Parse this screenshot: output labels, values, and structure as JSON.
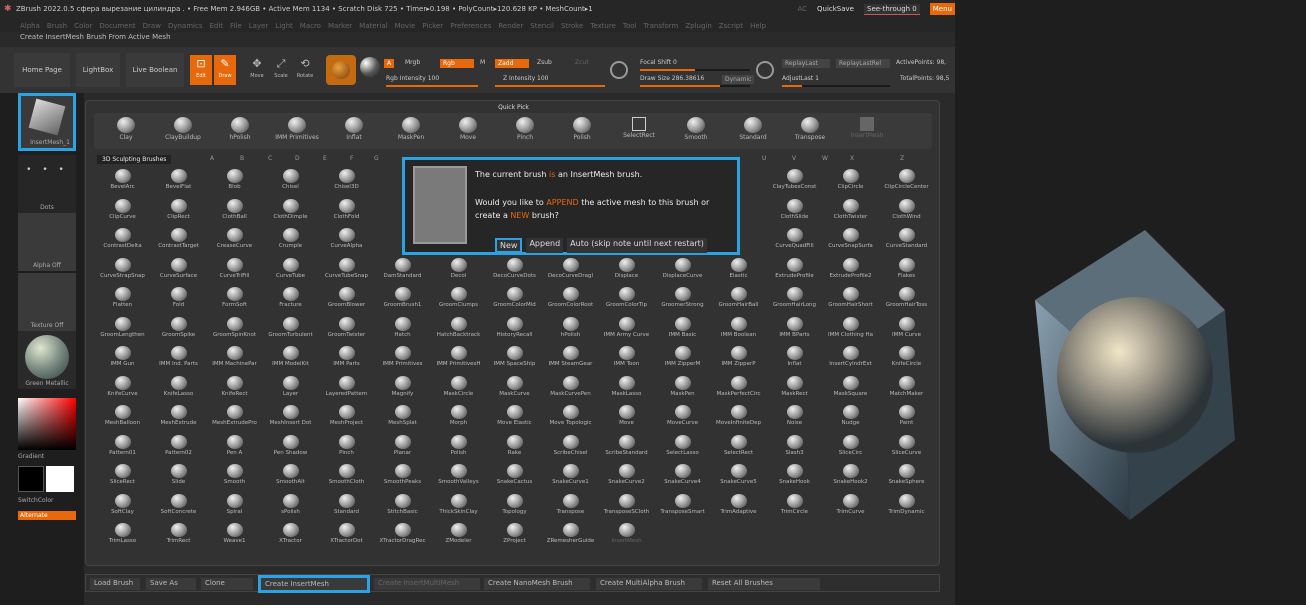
{
  "titlebar": {
    "title": "ZBrush 2022.0.5  сфера вырезание цилиндра  . • Free Mem 2.946GB • Active Mem 1134 • Scratch Disk 725 • Timer▸0.198 • PolyCount▸120.628 KP • MeshCount▸1",
    "ac": "AC",
    "quicksave": "QuickSave",
    "seethrough": "See-through  0",
    "menus": "Menu"
  },
  "menubar": [
    "Alpha",
    "Brush",
    "Color",
    "Document",
    "Draw",
    "Dynamics",
    "Edit",
    "File",
    "Layer",
    "Light",
    "Macro",
    "Marker",
    "Material",
    "Movie",
    "Picker",
    "Preferences",
    "Render",
    "Stencil",
    "Stroke",
    "Texture",
    "Tool",
    "Transform",
    "Zplugin",
    "Zscript",
    "Help"
  ],
  "subtitle": "Create InsertMesh Brush From Active Mesh",
  "toolbar": {
    "home": "Home Page",
    "lightbox": "LightBox",
    "liveboolean": "Live Boolean",
    "edit": "Edit",
    "draw": "Draw",
    "move": "Move",
    "scale": "Scale",
    "rotate": "Rotate",
    "mrgb": "Mrgb",
    "rgb": "Rgb",
    "m": "M",
    "zadd": "Zadd",
    "zsub": "Zsub",
    "zcut": "Zcut",
    "rgb_int": "Rgb Intensity 100",
    "z_int": "Z Intensity 100",
    "a": "A",
    "focal": "Focal Shift 0",
    "drawsize": "Draw Size 286.38616",
    "dynamic": "Dynamic",
    "replaylast": "ReplayLast",
    "replaylastrel": "ReplayLastRel",
    "adjustlast": "AdjustLast 1",
    "activepoints": "ActivePoints: 98,",
    "totalpoints": "TotalPoints: 98,5"
  },
  "left": {
    "insertmesh": "InsertMesh_1",
    "dots": "Dots",
    "alphaoff": "Alpha Off",
    "textureoff": "Texture Off",
    "material": "Green Metallic",
    "gradient": "Gradient",
    "switchcolor": "SwitchColor",
    "alternate": "Alternate"
  },
  "quickpick": {
    "title": "Quick Pick",
    "items": [
      "Clay",
      "ClayBuildup",
      "hPolish",
      "IMM Primitives",
      "Inflat",
      "MaskPen",
      "Move",
      "Pinch",
      "Polish",
      "SelectRect",
      "Smooth",
      "Standard",
      "Transpose",
      "InsertMesh"
    ],
    "imm_count": "14",
    "im_count": "1"
  },
  "tabs": {
    "label": "3D Sculpting Brushes",
    "letters": [
      "A",
      "B",
      "C",
      "D",
      "E",
      "F",
      "G",
      "U",
      "V",
      "W",
      "X",
      "Z"
    ]
  },
  "grid": [
    [
      "BevelArc",
      "BevelFlat",
      "Blob",
      "Chisel",
      "Chisel3D",
      "ChiselC",
      "",
      "",
      "",
      "",
      "",
      "",
      "ClayTubesConst",
      "ClipCircle",
      "ClipCircleCenter"
    ],
    [
      "ClipCurve",
      "ClipRect",
      "ClothBall",
      "ClothDimple",
      "ClothFold",
      "Cloth",
      "",
      "",
      "",
      "",
      "",
      "",
      "ClothSlide",
      "ClothTwister",
      "ClothWind"
    ],
    [
      "ContrastDelta",
      "ContrastTarget",
      "CreaseCurve",
      "Crumple",
      "CurveAlpha",
      "Curve",
      "",
      "",
      "",
      "",
      "",
      "",
      "CurveQuadFill",
      "CurveSnapSurfa",
      "CurveStandard"
    ],
    [
      "CurveStrapSnap",
      "CurveSurface",
      "CurveTriFill",
      "CurveTube",
      "CurveTubeSnap",
      "DamStandard",
      "Decol",
      "DecoCurveDots",
      "DecoCurveDragl",
      "Displace",
      "DisplaceCurve",
      "Elastic",
      "ExtrudeProfile",
      "ExtrudeProfile2",
      "Flakes"
    ],
    [
      "Flatten",
      "Fold",
      "FormSoft",
      "Fracture",
      "GroomBlower",
      "GroomBrush1",
      "GroomClumps",
      "GroomColorMid",
      "GroomColorRoot",
      "GroomColorTip",
      "GroomerStrong",
      "GroomHairBall",
      "GroomHairLong",
      "GroomHairShort",
      "GroomHairToss"
    ],
    [
      "GroomLengthen",
      "GroomSpike",
      "GroomSpinKnot",
      "GroomTurbulent",
      "GroomTwister",
      "Hatch",
      "HatchBacktrack",
      "HistoryRecall",
      "hPolish",
      "IMM Army Curve",
      "IMM Basic",
      "IMM Boolean",
      "IMM BParts",
      "IMM Clothing Ha",
      "IMM Curve"
    ],
    [
      "IMM Gun",
      "IMM Ind. Parts",
      "IMM MachinePar",
      "IMM ModelKit",
      "IMM Parts",
      "IMM Primitives",
      "IMM PrimitivesH",
      "IMM SpaceShip",
      "IMM SteamGear",
      "IMM Toon",
      "IMM ZipperM",
      "IMM ZipperP",
      "Inflat",
      "InsertCylndrExt",
      "KnifeCircle"
    ],
    [
      "KnifeCurve",
      "KnifeLasso",
      "KnifeRect",
      "Layer",
      "LayeredPattern",
      "Magnify",
      "MaskCircle",
      "MaskCurve",
      "MaskCurvePen",
      "MaskLasso",
      "MaskPen",
      "MaskPerfectCirc",
      "MaskRect",
      "MaskSquare",
      "MatchMaker"
    ],
    [
      "MeshBalloon",
      "MeshExtrude",
      "MeshExtrudePro",
      "MeshInsert Dot",
      "MeshProject",
      "MeshSplat",
      "Morph",
      "Move Elastic",
      "Move Topologic",
      "Move",
      "MoveCurve",
      "MoveInfiniteDep",
      "Noise",
      "Nudge",
      "Paint"
    ],
    [
      "Pattern01",
      "Pattern02",
      "Pen A",
      "Pen Shadow",
      "Pinch",
      "Planar",
      "Polish",
      "Rake",
      "ScribeChisel",
      "ScribeStandard",
      "SelectLasso",
      "SelectRect",
      "Slash3",
      "SliceCirc",
      "SliceCurve"
    ],
    [
      "SliceRect",
      "Slide",
      "Smooth",
      "SmoothAlt",
      "SmoothCloth",
      "SmoothPeaks",
      "SmoothValleys",
      "SnakeCactus",
      "SnakeCurve1",
      "SnakeCurve2",
      "SnakeCurve4",
      "SnakeCurve5",
      "SnakeHook",
      "SnakeHook2",
      "SnakeSphere"
    ],
    [
      "SoftClay",
      "SoftConcrete",
      "Spiral",
      "sPolish",
      "Standard",
      "StitchBasic",
      "ThickSkinClay",
      "Topology",
      "Transpose",
      "TransposeSCloth",
      "TransposeSmart",
      "TrimAdaptive",
      "TrimCircle",
      "TrimCurve",
      "TrimDynamic"
    ],
    [
      "TrimLasso",
      "TrimRect",
      "Weave1",
      "XTractor",
      "XTractorDot",
      "XTractorDragRec",
      "ZModeler",
      "ZProject",
      "ZRemesherGuide",
      "InsertMesh",
      "",
      "",
      "",
      "",
      ""
    ]
  ],
  "badges": {
    "chisel": "3",
    "chisel3d": "17",
    "imm_gun": "106",
    "imm_ind": "12",
    "imm_machine": "30",
    "imm_model": "120",
    "imm_parts": "68",
    "imm_prim": "14",
    "imm_primh": "12",
    "imm_space": "162",
    "imm_steam": "32",
    "imm_toon": "52",
    "imm_zipm": "6",
    "imm_zipp": "6",
    "imm_army": "7",
    "imm_basic": "8",
    "imm_bool": "37",
    "imm_bparts": "20",
    "imm_cloth": "13",
    "imm_curve": "30",
    "extrude": "31",
    "extrude2": "23",
    "zmodeler": "1"
  },
  "dialog": {
    "line1_a": "The current brush ",
    "line1_b": "is",
    "line1_c": " an InsertMesh brush.",
    "line2_a": "Would you like to ",
    "line2_b": "APPEND",
    "line2_c": " the active mesh to this brush or",
    "line3_a": "create a ",
    "line3_b": "NEW",
    "line3_c": " brush?",
    "new": "New",
    "append": "Append",
    "auto": "Auto (skip note until next restart)"
  },
  "bottom": [
    "Load Brush",
    "Save As",
    "Clone",
    "Create InsertMesh",
    "Create InsertMultiMesh",
    "Create NanoMesh Brush",
    "Create MultiAlpha Brush",
    "Reset All Brushes"
  ]
}
